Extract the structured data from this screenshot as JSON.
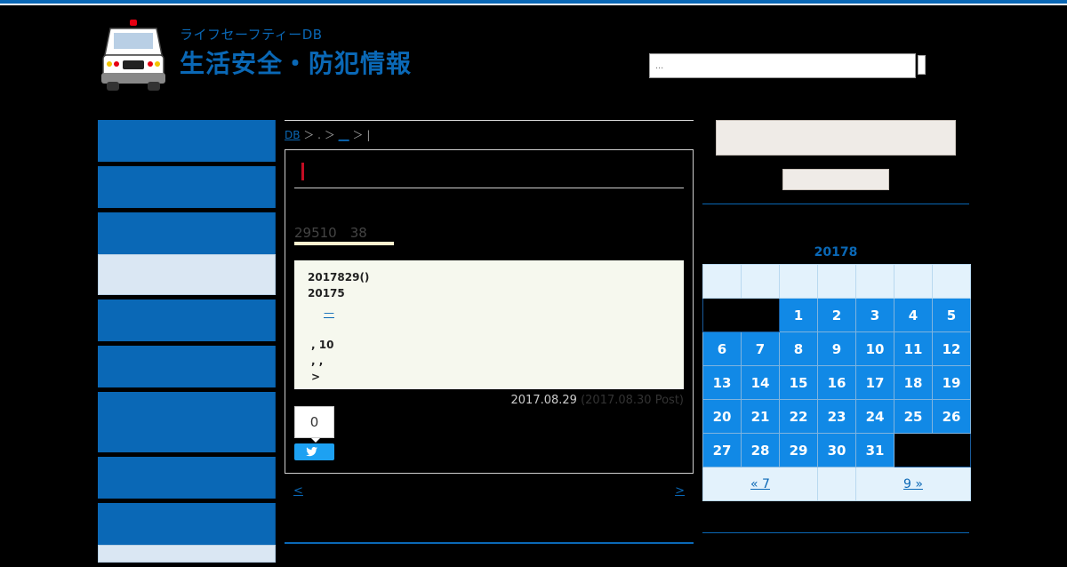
{
  "header": {
    "subtitle": "ライフセーフティーDB",
    "title": "生活安全・防犯情報",
    "search_placeholder": "..."
  },
  "breadcrumb": {
    "home": "DB",
    "separator1": "＞",
    "crumb2": ".",
    "separator2": "＞",
    "crumb3": "__",
    "separator3": "＞",
    "current": "|"
  },
  "post": {
    "subhead": "29510　38",
    "note_lines": [
      "2017829()",
      "20175",
      "—",
      "",
      ", 10",
      ",  ,",
      ">"
    ],
    "date_published": "2017.08.29",
    "date_posted": "(2017.08.30 Post)",
    "share_count": "0"
  },
  "pager": {
    "prev": "<",
    "next": ">"
  },
  "calendar": {
    "caption": "20178",
    "prev_link": "« 7",
    "next_link": "9 »",
    "weeks": [
      [
        "",
        "",
        "1",
        "2",
        "3",
        "4",
        "5"
      ],
      [
        "6",
        "7",
        "8",
        "9",
        "10",
        "11",
        "12"
      ],
      [
        "13",
        "14",
        "15",
        "16",
        "17",
        "18",
        "19"
      ],
      [
        "20",
        "21",
        "22",
        "23",
        "24",
        "25",
        "26"
      ],
      [
        "27",
        "28",
        "29",
        "30",
        "31",
        "",
        ""
      ]
    ]
  },
  "colors": {
    "brand_blue": "#0a68b6",
    "calendar_blue": "#1189e6",
    "title_red": "#c30d23"
  }
}
